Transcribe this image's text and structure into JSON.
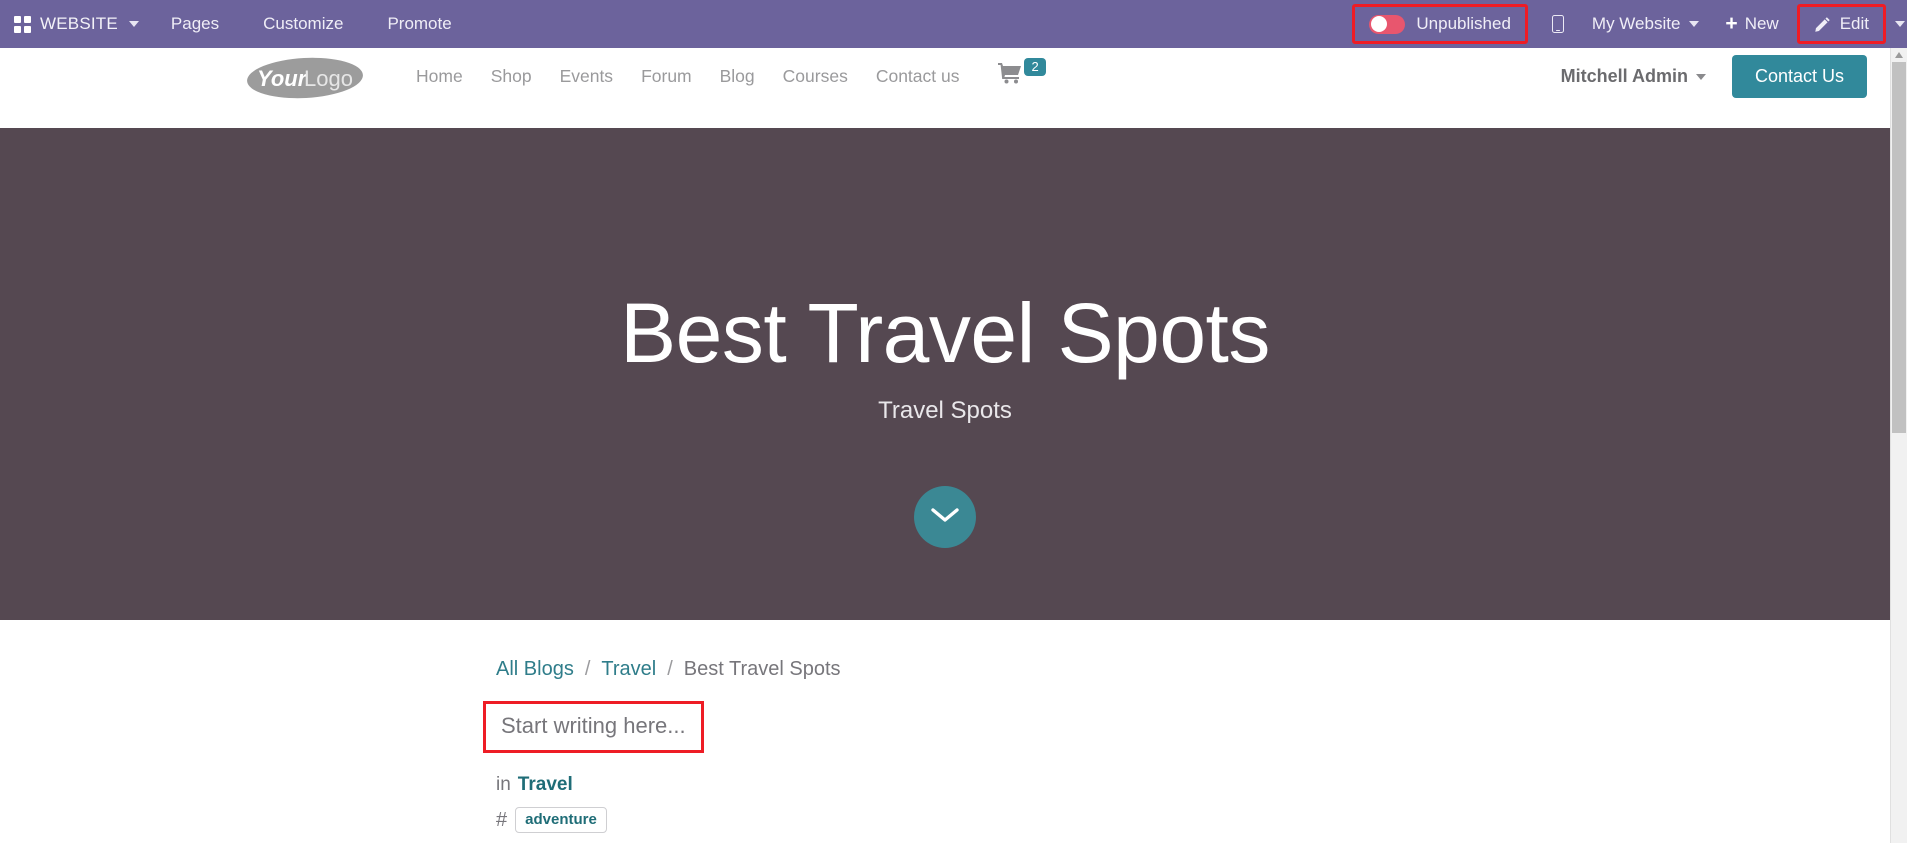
{
  "backend_navbar": {
    "apps_icon": "grid-apps-icon",
    "apps_label": "WEBSITE",
    "menu_items": [
      {
        "label": "Pages"
      },
      {
        "label": "Customize"
      },
      {
        "label": "Promote"
      }
    ],
    "publish_toggle": {
      "state": "off",
      "label": "Unpublished",
      "highlighted": true,
      "highlight_color": "#ee1c25",
      "toggle_color": "#e8566e"
    },
    "mobile_preview_icon": "mobile-phone-icon",
    "my_website_label": "My Website",
    "new_label": "New",
    "new_icon": "plus-icon",
    "edit_label": "Edit",
    "edit_icon": "pencil-icon",
    "edit_highlighted": true,
    "navbar_color": "#6C639C"
  },
  "site_header": {
    "logo_text_bold": "Your",
    "logo_text_light": "Logo",
    "nav_items": [
      {
        "label": "Home"
      },
      {
        "label": "Shop"
      },
      {
        "label": "Events"
      },
      {
        "label": "Forum"
      },
      {
        "label": "Blog"
      },
      {
        "label": "Courses"
      },
      {
        "label": "Contact us"
      }
    ],
    "cart_icon": "shopping-cart-icon",
    "cart_count": "2",
    "user_name": "Mitchell Admin",
    "cta_label": "Contact Us",
    "accent_color": "#31899B"
  },
  "hero": {
    "title": "Best Travel Spots",
    "subtitle": "Travel Spots",
    "background_color": "#554851",
    "scroll_button_icon": "chevron-down-icon",
    "scroll_button_color": "#3B8894"
  },
  "blog": {
    "breadcrumb": {
      "items": [
        {
          "label": "All Blogs",
          "type": "link"
        },
        {
          "label": "Travel",
          "type": "link"
        },
        {
          "label": "Best Travel Spots",
          "type": "current"
        }
      ],
      "separator": "/"
    },
    "editor": {
      "placeholder": "Start writing here...",
      "highlighted": true,
      "highlight_color": "#ee1c25"
    },
    "in_label": "in",
    "category": "Travel",
    "hash_symbol": "#",
    "tags": [
      {
        "label": "adventure"
      }
    ]
  },
  "scrollbar": {
    "orientation": "vertical",
    "thumb_color": "#c1c1c1",
    "track_color": "#f1f1f1"
  }
}
